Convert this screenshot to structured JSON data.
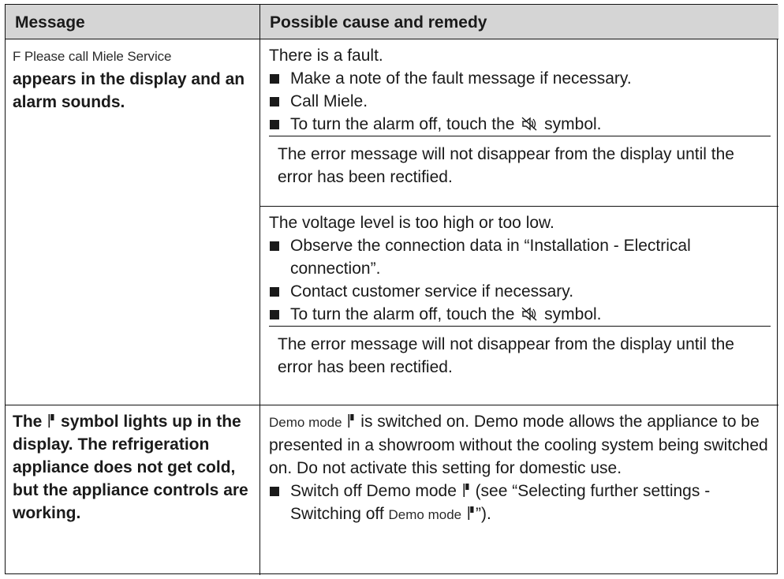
{
  "header": {
    "message": "Message",
    "cause": "Possible cause and remedy"
  },
  "row1": {
    "message_display": "F Please call Miele Service",
    "message_rest": "appears in the display and an alarm sounds.",
    "cause_a": {
      "intro": "There is a fault.",
      "bullets": [
        "Make a note of the fault message if necessary.",
        "Call Miele."
      ],
      "alarm_before": "To turn the alarm off, touch the",
      "alarm_after": "symbol.",
      "note": "The error message will not disappear from the display until the error has been rectified."
    },
    "cause_b": {
      "intro": "The voltage level is too high or too low.",
      "bullets": [
        "Observe the connection data in “Installation - Electrical connection”.",
        "Contact customer service if necessary."
      ],
      "alarm_before": "To turn the alarm off, touch the",
      "alarm_after": "symbol.",
      "note": "The error message will not disappear from the display until the error has been rectified."
    }
  },
  "row2": {
    "message_before": "The",
    "message_after": "symbol lights up in the display. The refrigeration appliance does not get cold, but the appliance controls are working.",
    "demo_label": "Demo mode",
    "cause_text": "is switched on. Demo mode allows the appliance to be presented in a showroom without the cooling system being switched on. Do not activate this setting for domestic use.",
    "bullet_before": "Switch off Demo mode",
    "bullet_middle": "(see “Selecting further settings - Switching off",
    "bullet_demo_label": "Demo mode",
    "bullet_after": "”)."
  },
  "icons": {
    "bullet": "square-bullet-icon",
    "mute": "alarm-mute-icon",
    "demo": "demo-mode-icon"
  }
}
